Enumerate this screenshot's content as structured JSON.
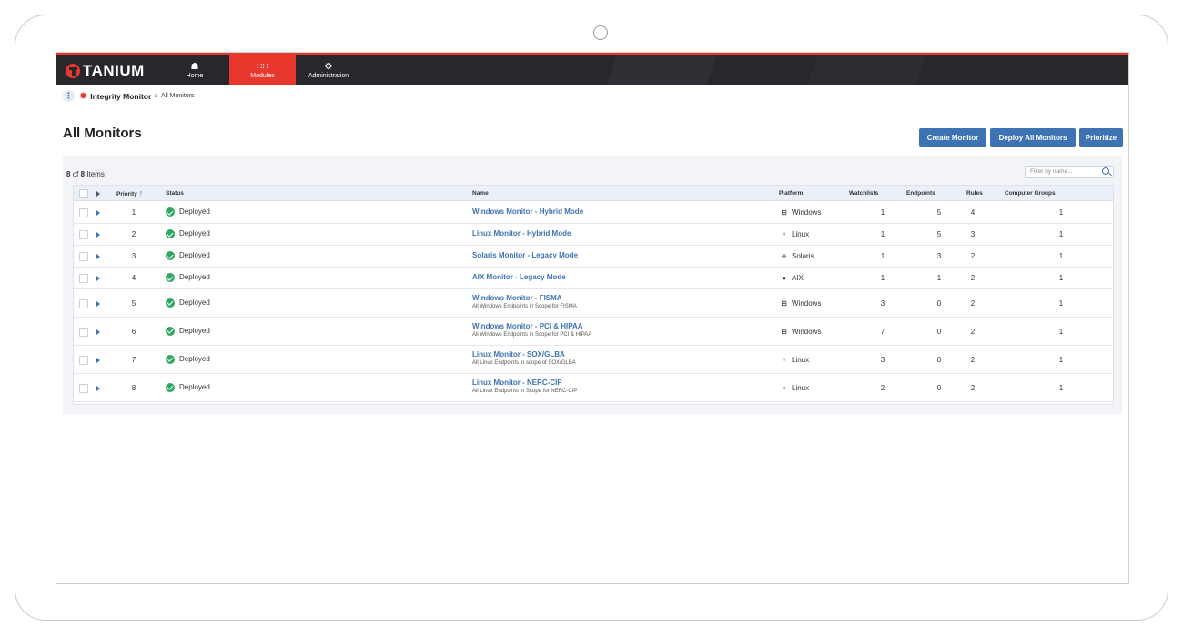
{
  "nav": {
    "brand": "TANIUM",
    "items": [
      {
        "label": "Home",
        "icon": "home-icon"
      },
      {
        "label": "Modules",
        "icon": "grid-icon"
      },
      {
        "label": "Administration",
        "icon": "gears-icon"
      }
    ],
    "accent": "#e8382e"
  },
  "breadcrumb": {
    "module": "Integrity Monitor",
    "separator": ">",
    "page": "All Monitors"
  },
  "page": {
    "title": "All Monitors",
    "buttons": {
      "create": "Create Monitor",
      "deploy": "Deploy All Monitors",
      "prioritize": "Prioritize"
    }
  },
  "list": {
    "count_shown": "8",
    "count_of": "of",
    "count_total": "8",
    "count_suffix": "Items",
    "filter_placeholder": "Filter by name..."
  },
  "table": {
    "headers": {
      "priority": "Priority",
      "status": "Status",
      "name": "Name",
      "platform": "Platform",
      "watchlists": "Watchlists",
      "endpoints": "Endpoints",
      "rules": "Rules",
      "groups": "Computer Groups"
    },
    "rows": [
      {
        "priority": "1",
        "status": "Deployed",
        "name": "Windows Monitor - Hybrid Mode",
        "desc": "",
        "platform": "Windows",
        "platform_icon": "windows-icon",
        "watchlists": "1",
        "endpoints": "5",
        "rules": "4",
        "groups": "1"
      },
      {
        "priority": "2",
        "status": "Deployed",
        "name": "Linux Monitor - Hybrid Mode",
        "desc": "",
        "platform": "Linux",
        "platform_icon": "linux-icon",
        "watchlists": "1",
        "endpoints": "5",
        "rules": "3",
        "groups": "1"
      },
      {
        "priority": "3",
        "status": "Deployed",
        "name": "Solaris Monitor - Legacy Mode",
        "desc": "",
        "platform": "Solaris",
        "platform_icon": "solaris-icon",
        "watchlists": "1",
        "endpoints": "3",
        "rules": "2",
        "groups": "1"
      },
      {
        "priority": "4",
        "status": "Deployed",
        "name": "AIX Monitor - Legacy Mode",
        "desc": "",
        "platform": "AIX",
        "platform_icon": "aix-icon",
        "watchlists": "1",
        "endpoints": "1",
        "rules": "2",
        "groups": "1"
      },
      {
        "priority": "5",
        "status": "Deployed",
        "name": "Windows Monitor - FISMA",
        "desc": "All Windows Endpoints in Scope for FISMA",
        "platform": "Windows",
        "platform_icon": "windows-icon",
        "watchlists": "3",
        "endpoints": "0",
        "rules": "2",
        "groups": "1"
      },
      {
        "priority": "6",
        "status": "Deployed",
        "name": "Windows Monitor - PCI & HIPAA",
        "desc": "All Windows Endpoints in Scope for PCI & HIPAA",
        "platform": "Windows",
        "platform_icon": "windows-icon",
        "watchlists": "7",
        "endpoints": "0",
        "rules": "2",
        "groups": "1"
      },
      {
        "priority": "7",
        "status": "Deployed",
        "name": "Linux Monitor - SOX/GLBA",
        "desc": "All Linux Endpoints in scope of SOX/GLBA",
        "platform": "Linux",
        "platform_icon": "linux-icon",
        "watchlists": "3",
        "endpoints": "0",
        "rules": "2",
        "groups": "1"
      },
      {
        "priority": "8",
        "status": "Deployed",
        "name": "Linux Monitor - NERC-CIP",
        "desc": "All Linux Endpoints in Scope for NERC-CIP",
        "platform": "Linux",
        "platform_icon": "linux-icon",
        "watchlists": "2",
        "endpoints": "0",
        "rules": "2",
        "groups": "1"
      }
    ]
  }
}
